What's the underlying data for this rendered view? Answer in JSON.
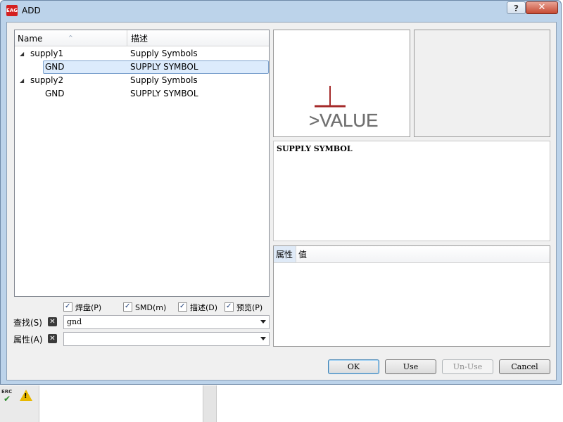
{
  "window": {
    "title": "ADD",
    "help_label": "?",
    "close_label": "✕"
  },
  "tree": {
    "columns": {
      "name": "Name",
      "description": "描述"
    },
    "rows": [
      {
        "name": "supply1",
        "description": "Supply Symbols",
        "expander": "◢"
      },
      {
        "name": "GND",
        "description": "SUPPLY SYMBOL"
      },
      {
        "name": "supply2",
        "description": "Supply Symbols",
        "expander": "◢"
      },
      {
        "name": "GND",
        "description": "SUPPLY SYMBOL"
      }
    ]
  },
  "filters": {
    "pads": "焊盘(P)",
    "smd": "SMD(m)",
    "description": "描述(D)",
    "preview": "预览(P)"
  },
  "search": {
    "label": "查找(S)",
    "value": "gnd"
  },
  "attributes_filter": {
    "label": "属性(A)",
    "value": ""
  },
  "preview": {
    "symbol_text": ">VALUE",
    "symbol_color": "#a52a2a"
  },
  "description_text": "SUPPLY SYMBOL",
  "attributes_table": {
    "col1": "属性",
    "col2": "值"
  },
  "buttons": {
    "ok": "OK",
    "use": "Use",
    "unuse": "Un-Use",
    "cancel": "Cancel"
  },
  "background_app": {
    "erc_label": "ERC"
  }
}
